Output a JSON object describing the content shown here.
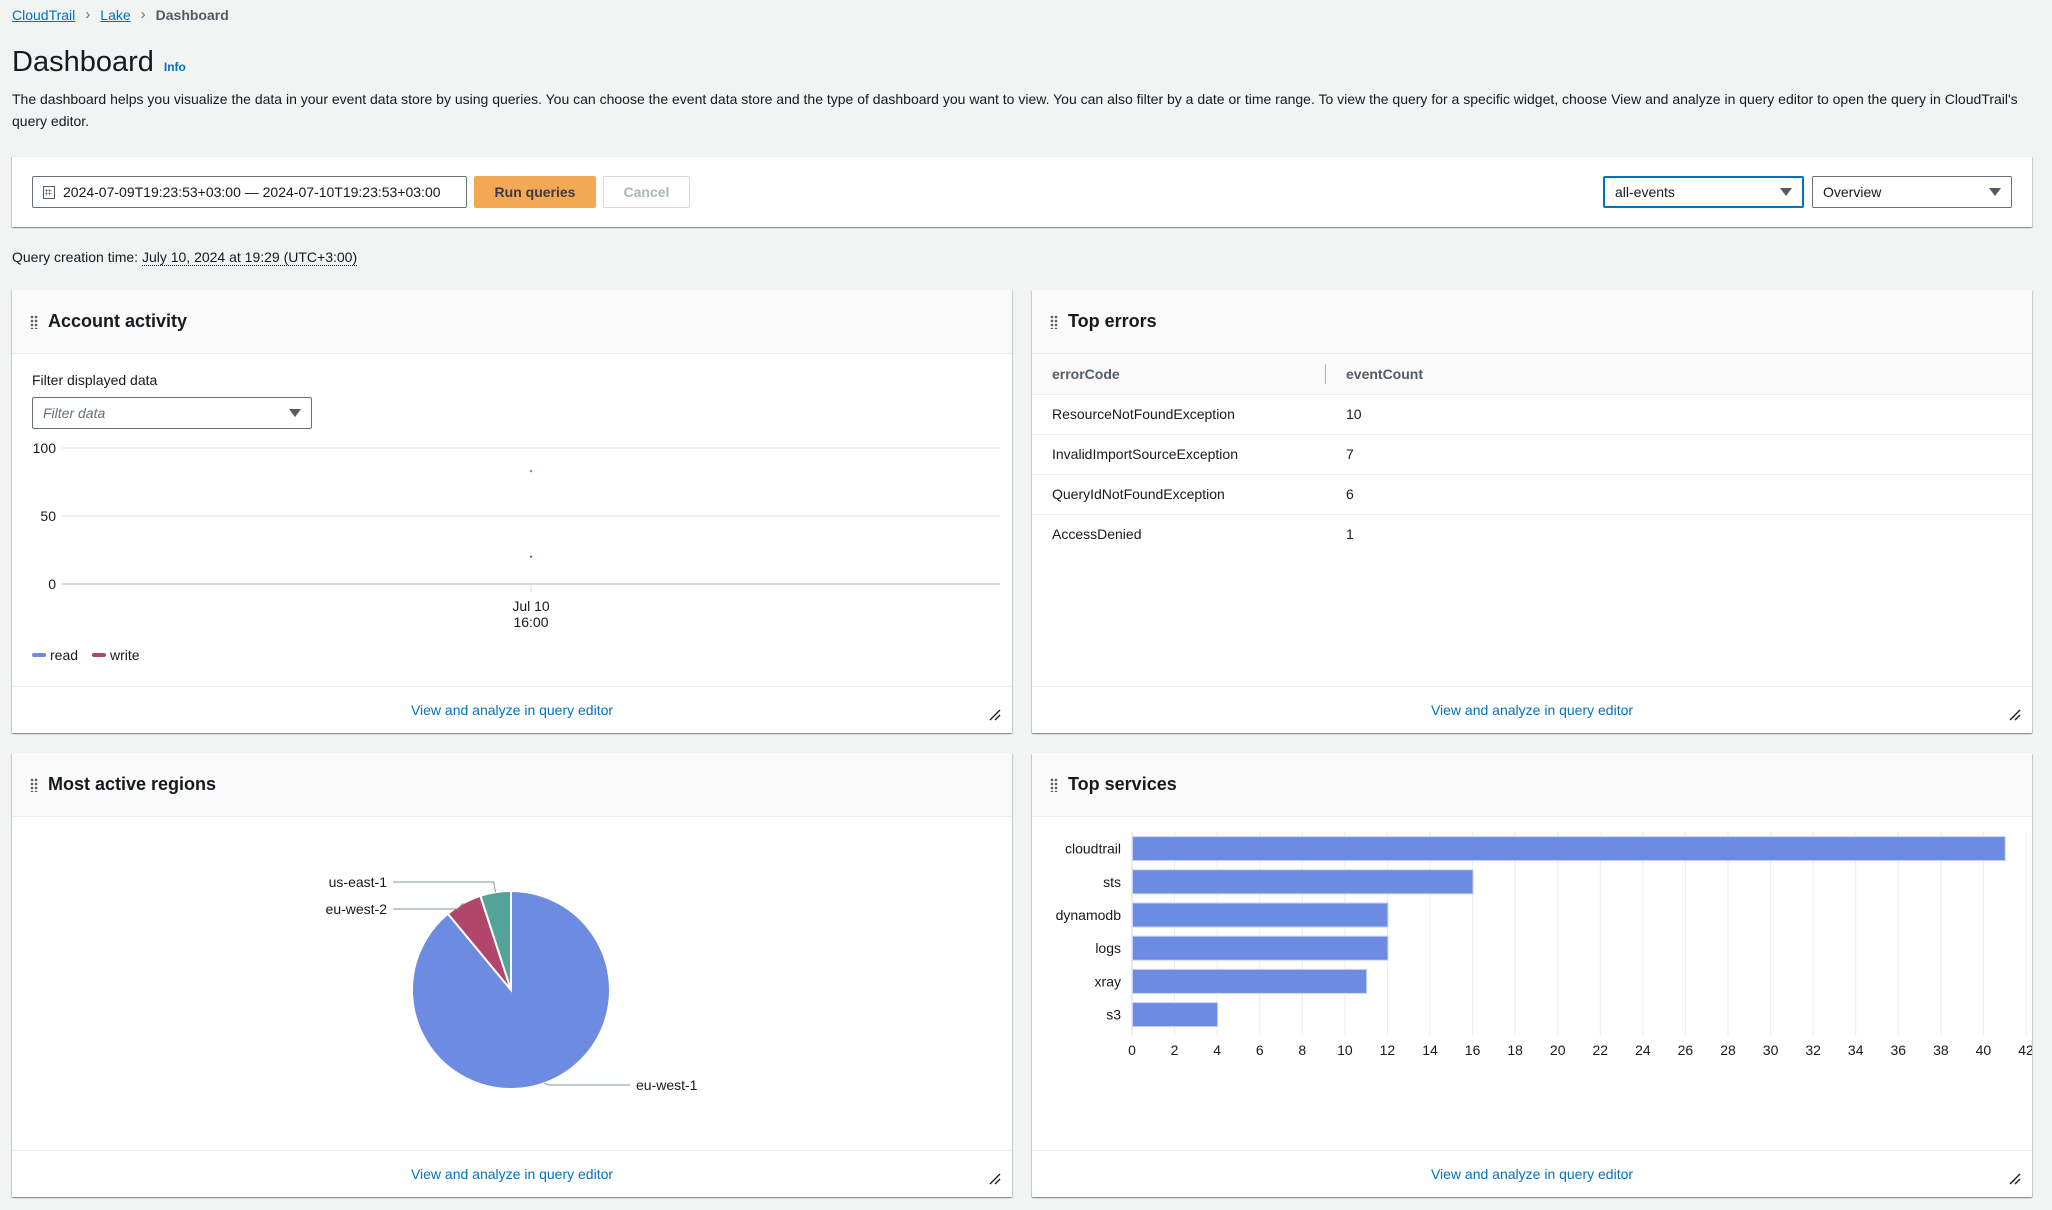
{
  "breadcrumb": [
    {
      "label": "CloudTrail",
      "link": true
    },
    {
      "label": "Lake",
      "link": true
    },
    {
      "label": "Dashboard",
      "link": false
    }
  ],
  "header": {
    "title": "Dashboard",
    "info": "Info",
    "description": "The dashboard helps you visualize the data in your event data store by using queries. You can choose the event data store and the type of dashboard you want to view. You can also filter by a date or time range. To view the query for a specific widget, choose View and analyze in query editor to open the query in CloudTrail's query editor."
  },
  "toolbar": {
    "date_range": "2024-07-09T19:23:53+03:00 — 2024-07-10T19:23:53+03:00",
    "run_label": "Run queries",
    "cancel_label": "Cancel",
    "event_data_store": "all-events",
    "dashboard_type": "Overview"
  },
  "query_time": {
    "label": "Query creation time: ",
    "value": "July 10, 2024 at 19:29 (UTC+3:00)"
  },
  "widgets": {
    "account_activity": {
      "title": "Account activity",
      "filter_label": "Filter displayed data",
      "filter_placeholder": "Filter data",
      "footer_link": "View and analyze in query editor"
    },
    "top_errors": {
      "title": "Top errors",
      "columns": [
        "errorCode",
        "eventCount"
      ],
      "rows": [
        [
          "ResourceNotFoundException",
          "10"
        ],
        [
          "InvalidImportSourceException",
          "7"
        ],
        [
          "QueryIdNotFoundException",
          "6"
        ],
        [
          "AccessDenied",
          "1"
        ]
      ],
      "footer_link": "View and analyze in query editor"
    },
    "most_active_regions": {
      "title": "Most active regions",
      "footer_link": "View and analyze in query editor"
    },
    "top_services": {
      "title": "Top services",
      "footer_link": "View and analyze in query editor"
    }
  },
  "colors": {
    "series_blue": "#6e8be2",
    "series_red": "#b2466a",
    "series_teal": "#53a396",
    "link": "#0073bb",
    "primary_button": "#f29a38"
  },
  "chart_data": [
    {
      "id": "account_activity",
      "type": "line",
      "title": "Account activity",
      "x": [
        "Jul 10 16:00"
      ],
      "x_tick_labels": [
        [
          "Jul 10",
          "16:00"
        ]
      ],
      "series": [
        {
          "name": "read",
          "values": [
            83
          ],
          "color": "#6e8be2"
        },
        {
          "name": "write",
          "values": [
            20
          ],
          "color": "#b2466a"
        }
      ],
      "ylim": [
        0,
        100
      ],
      "yticks": [
        0,
        50,
        100
      ],
      "grid": true,
      "legend": "bottom-left"
    },
    {
      "id": "most_active_regions",
      "type": "pie",
      "title": "Most active regions",
      "slices": [
        {
          "label": "eu-west-1",
          "value": 89,
          "color": "#6e8be2"
        },
        {
          "label": "eu-west-2",
          "value": 6,
          "color": "#b2466a"
        },
        {
          "label": "us-east-1",
          "value": 5,
          "color": "#53a396"
        }
      ]
    },
    {
      "id": "top_services",
      "type": "bar",
      "orientation": "horizontal",
      "title": "Top services",
      "categories": [
        "cloudtrail",
        "sts",
        "dynamodb",
        "logs",
        "xray",
        "s3"
      ],
      "values": [
        41,
        16,
        12,
        12,
        11,
        4
      ],
      "xlim": [
        0,
        42
      ],
      "xticks": [
        0,
        2,
        4,
        6,
        8,
        10,
        12,
        14,
        16,
        18,
        20,
        22,
        24,
        26,
        28,
        30,
        32,
        34,
        36,
        38,
        40,
        42
      ],
      "grid": true,
      "color": "#6e8be2"
    }
  ]
}
